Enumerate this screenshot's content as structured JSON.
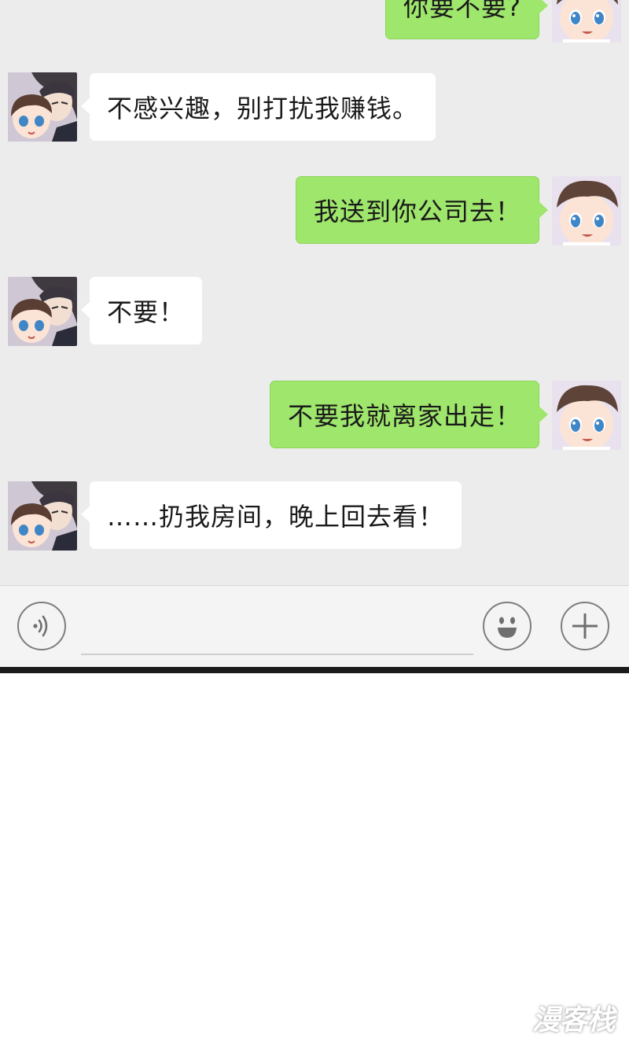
{
  "messages": [
    {
      "side": "right",
      "text": "你要不要?"
    },
    {
      "side": "left",
      "text": "不感兴趣，别打扰我赚钱。"
    },
    {
      "side": "right",
      "text": "我送到你公司去！"
    },
    {
      "side": "left",
      "text": "不要！"
    },
    {
      "side": "right",
      "text": "不要我就离家出走！"
    },
    {
      "side": "left",
      "text": "……扔我房间，晚上回去看！"
    }
  ],
  "input_bar": {
    "message_value": "",
    "voice_icon": "voice-icon",
    "emoji_icon": "emoji-icon",
    "plus_icon": "plus-icon"
  },
  "watermark": {
    "text": "漫客栈"
  },
  "colors": {
    "chat_background": "#ececec",
    "sent_bubble": "#9fe66c",
    "received_bubble": "#ffffff"
  }
}
